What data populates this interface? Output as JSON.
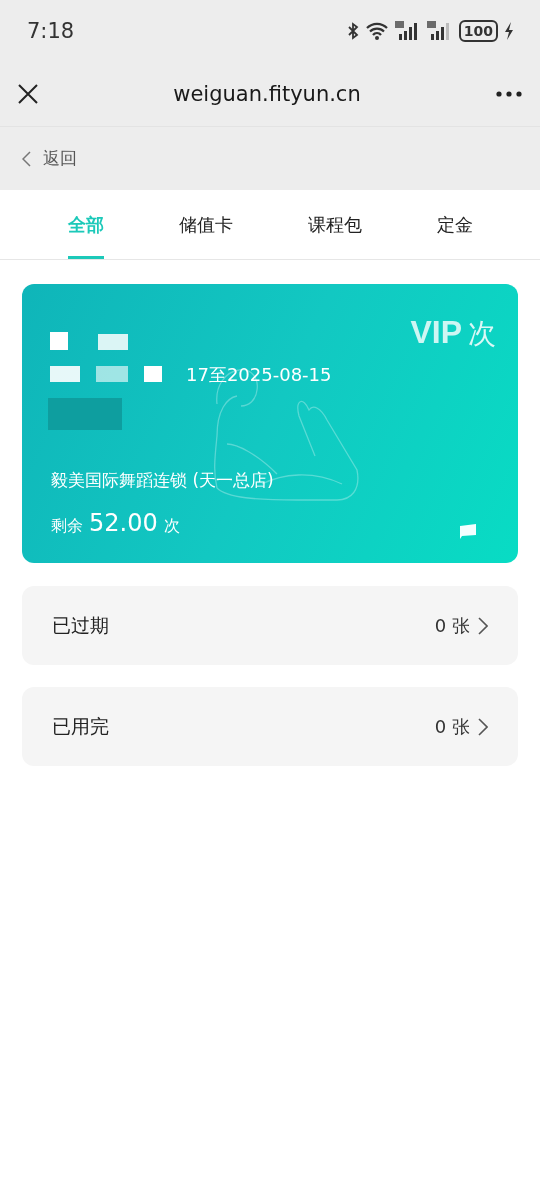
{
  "status_bar": {
    "time": "7:18",
    "battery": "100"
  },
  "browser": {
    "title": "weiguan.fityun.cn"
  },
  "back": {
    "label": "返回"
  },
  "tabs": [
    {
      "label": "全部",
      "selected": true
    },
    {
      "label": "储值卡",
      "selected": false
    },
    {
      "label": "课程包",
      "selected": false
    },
    {
      "label": "定金",
      "selected": false
    }
  ],
  "card": {
    "vip": "VIP",
    "type": "次",
    "validity": "17至2025-08-15",
    "store": "毅美国际舞蹈连锁 (天一总店)",
    "remaining_label": "剩余",
    "remaining_value": "52.00",
    "remaining_unit": "次"
  },
  "status_rows": [
    {
      "label": "已过期",
      "count": "0 张"
    },
    {
      "label": "已用完",
      "count": "0 张"
    }
  ]
}
